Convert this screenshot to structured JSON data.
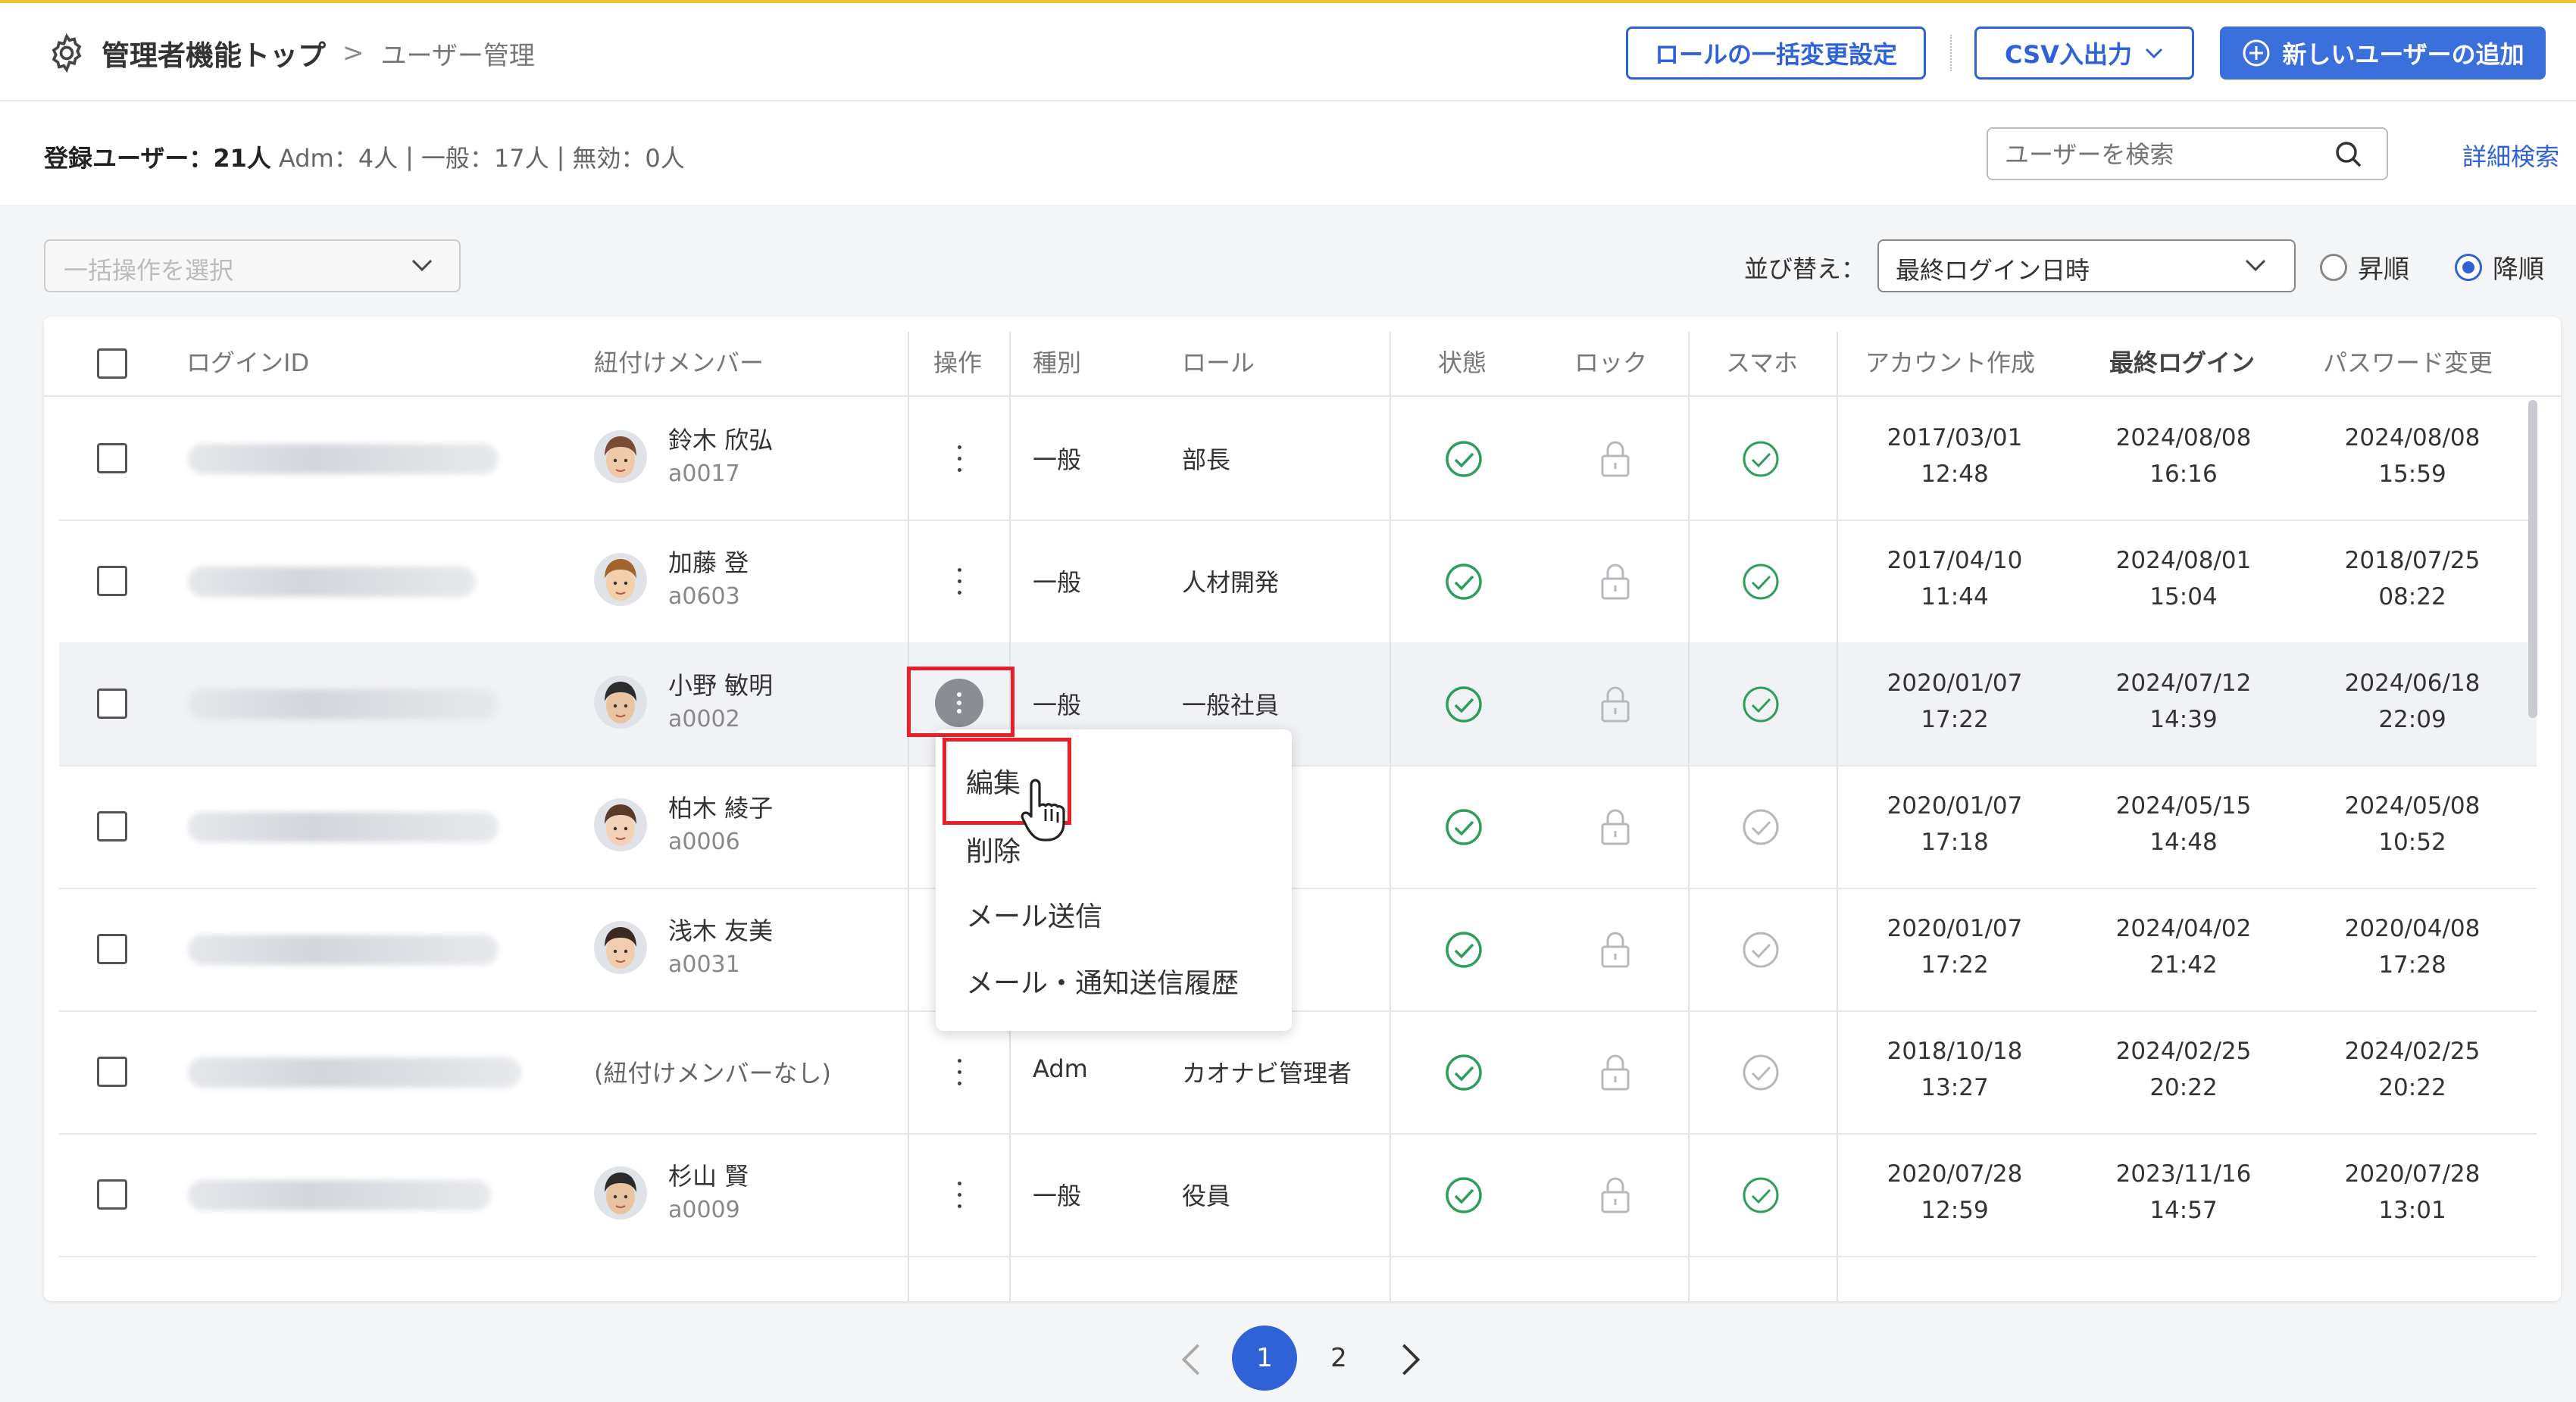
{
  "header": {
    "title": "管理者機能トップ",
    "breadcrumb_sep": ">",
    "breadcrumb_current": "ユーザー管理",
    "btn_bulk_role": "ロールの一括変更設定",
    "btn_csv": "CSV入出力",
    "btn_add_user": "新しいユーザーの追加"
  },
  "summary": {
    "registered": "登録ユーザー：21人",
    "adm": "Adm：4人",
    "general": "一般：17人",
    "inactive": "無効：0人",
    "sep": "|"
  },
  "search": {
    "placeholder": "ユーザーを検索",
    "advanced": "詳細検索"
  },
  "bulk_select": {
    "placeholder": "一括操作を選択"
  },
  "sort": {
    "label": "並び替え：",
    "value": "最終ログイン日時",
    "asc": "昇順",
    "desc": "降順",
    "selected": "desc"
  },
  "columns": {
    "login_id": "ログインID",
    "member": "紐付けメンバー",
    "action": "操作",
    "type": "種別",
    "role": "ロール",
    "status": "状態",
    "lock": "ロック",
    "phone": "スマホ",
    "created": "アカウント作成",
    "last_login": "最終ログイン",
    "pw_changed": "パスワード変更"
  },
  "rows": [
    {
      "name": "鈴木 欣弘",
      "id": "a0017",
      "type": "一般",
      "role": "部長",
      "phone": "on",
      "created_d": "2017/03/01",
      "created_t": "12:48",
      "login_d": "2024/08/08",
      "login_t": "16:16",
      "pw_d": "2024/08/08",
      "pw_t": "15:59"
    },
    {
      "name": "加藤 登",
      "id": "a0603",
      "type": "一般",
      "role": "人材開発",
      "phone": "on",
      "created_d": "2017/04/10",
      "created_t": "11:44",
      "login_d": "2024/08/01",
      "login_t": "15:04",
      "pw_d": "2018/07/25",
      "pw_t": "08:22"
    },
    {
      "name": "小野 敏明",
      "id": "a0002",
      "type": "一般",
      "role": "一般社員",
      "phone": "on",
      "created_d": "2020/01/07",
      "created_t": "17:22",
      "login_d": "2024/07/12",
      "login_t": "14:39",
      "pw_d": "2024/06/18",
      "pw_t": "22:09"
    },
    {
      "name": "柏木 綾子",
      "id": "a0006",
      "type": "",
      "role": "",
      "phone": "off",
      "created_d": "2020/01/07",
      "created_t": "17:18",
      "login_d": "2024/05/15",
      "login_t": "14:48",
      "pw_d": "2024/05/08",
      "pw_t": "10:52"
    },
    {
      "name": "浅木 友美",
      "id": "a0031",
      "type": "",
      "role": "",
      "phone": "off",
      "created_d": "2020/01/07",
      "created_t": "17:22",
      "login_d": "2024/04/02",
      "login_t": "21:42",
      "pw_d": "2020/04/08",
      "pw_t": "17:28"
    },
    {
      "name": "(紐付けメンバーなし)",
      "id": "",
      "type": "Adm",
      "role": "カオナビ管理者",
      "phone": "off",
      "created_d": "2018/10/18",
      "created_t": "13:27",
      "login_d": "2024/02/25",
      "login_t": "20:22",
      "pw_d": "2024/02/25",
      "pw_t": "20:22"
    },
    {
      "name": "杉山 賢",
      "id": "a0009",
      "type": "一般",
      "role": "役員",
      "phone": "on",
      "created_d": "2020/07/28",
      "created_t": "12:59",
      "login_d": "2023/11/16",
      "login_t": "14:57",
      "pw_d": "2020/07/28",
      "pw_t": "13:01"
    }
  ],
  "context_menu": {
    "edit": "編集",
    "delete": "削除",
    "mail": "メール送信",
    "history": "メール・通知送信履歴"
  },
  "pagination": {
    "page1": "1",
    "page2": "2",
    "current": 1
  },
  "colors": {
    "accent": "#2f62d6",
    "check_green": "#2e9e5b",
    "highlight": "#e8202a"
  }
}
